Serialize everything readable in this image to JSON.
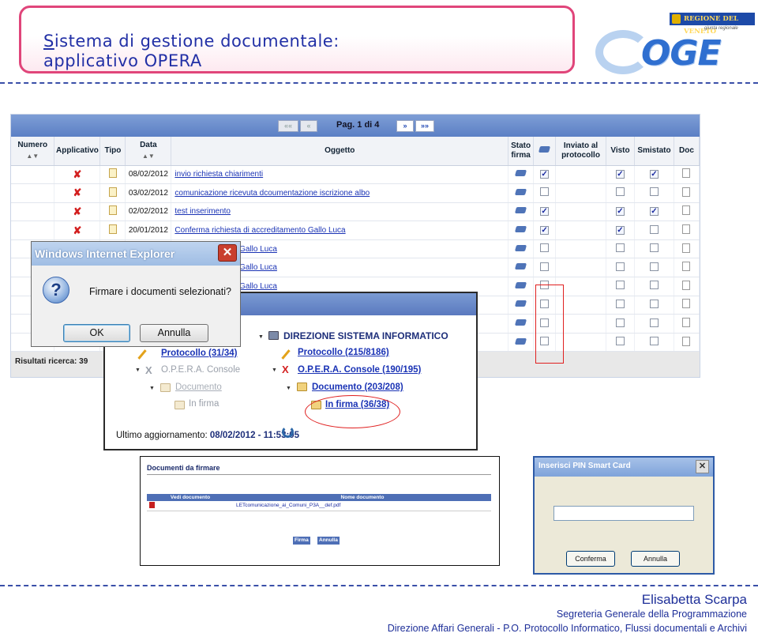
{
  "header": {
    "title_first_letter": "S",
    "title_rest": "istema di gestione documentale:",
    "title_line2": "applicativo OPERA",
    "logo_region": "REGIONE DEL VENETO",
    "logo_region_sub": "giunta regionale",
    "logo_word": "OGE"
  },
  "grid": {
    "pager": {
      "first": "««",
      "prev": "«",
      "page_label": "Pag. 1 di 4",
      "next": "»",
      "last": "»»"
    },
    "columns": {
      "numero": "Numero",
      "applicativo": "Applicativo",
      "tipo": "Tipo",
      "data": "Data",
      "oggetto": "Oggetto",
      "stato_firma": "Stato firma",
      "inviato": "Inviato al protocollo",
      "visto": "Visto",
      "smistato": "Smistato",
      "doc": "Doc"
    },
    "rows": [
      {
        "data": "08/02/2012",
        "oggetto": "invio richiesta chiarimenti",
        "sel": true,
        "visto": true,
        "smistato": true
      },
      {
        "data": "03/02/2012",
        "oggetto": "comunicazione ricevuta dcoumentazione iscrizione albo",
        "sel": false,
        "visto": false,
        "smistato": false
      },
      {
        "data": "02/02/2012",
        "oggetto": "test inserimento",
        "sel": true,
        "visto": true,
        "smistato": true
      },
      {
        "data": "20/01/2012",
        "oggetto": "Conferma richiesta di accreditamento Gallo Luca",
        "sel": true,
        "visto": true,
        "smistato": false
      },
      {
        "data": "",
        "oggetto": "di accreditamento Gallo Luca",
        "sel": false,
        "visto": false,
        "smistato": false
      },
      {
        "data": "",
        "oggetto": "di accreditamento Gallo Luca",
        "sel": false,
        "visto": false,
        "smistato": false
      },
      {
        "data": "",
        "oggetto": "di accreditamento Gallo Luca",
        "sel": false,
        "visto": false,
        "smistato": false
      },
      {
        "data": "",
        "oggetto": "",
        "sel": false,
        "visto": false,
        "smistato": false
      },
      {
        "data": "",
        "oggetto": "",
        "sel": false,
        "visto": false,
        "smistato": false
      },
      {
        "data": "",
        "oggetto": "",
        "sel": false,
        "visto": false,
        "smistato": false
      }
    ],
    "results": "Risultati ricerca: 39"
  },
  "ie_dialog": {
    "title": "Windows Internet Explorer",
    "close": "✕",
    "message": "Firmare i documenti selezionati?",
    "ok": "OK",
    "cancel": "Annulla"
  },
  "tree": {
    "left": {
      "protocollo": "Protocollo (31/34)",
      "console": "O.P.E.R.A. Console",
      "documento": "Documento",
      "in_firma": "In firma"
    },
    "right": {
      "direzione": "DIREZIONE SISTEMA INFORMATICO",
      "protocollo": "Protocollo (215/8186)",
      "console": "O.P.E.R.A. Console (190/195)",
      "documento": "Documento (203/208)",
      "in_firma": "In firma (36/38)"
    },
    "update_label": "Ultimo aggiornamento:",
    "update_value": "08/02/2012 - 11:53:05"
  },
  "docs_panel": {
    "title": "Documenti da firmare",
    "col_view": "Vedi documento",
    "col_name": "Nome documento",
    "file": "LETcomunicazione_ai_Comuni_P3A__def.pdf",
    "firma": "Firma",
    "annulla": "Annulla"
  },
  "pin_dialog": {
    "title": "Inserisci PIN Smart Card",
    "close": "✕",
    "confirm": "Conferma",
    "cancel": "Annulla"
  },
  "footer": {
    "author": "Elisabetta Scarpa",
    "line1": "Segreteria Generale della Programmazione",
    "line2": "Direzione Affari Generali - P.O. Protocollo Informatico, Flussi documentali e Archivi"
  },
  "colors": {
    "title_blue": "#2230a6",
    "title_border": "#e0457a",
    "grid_header_blue": "#5b7fc4",
    "highlight_red": "#e02020"
  }
}
